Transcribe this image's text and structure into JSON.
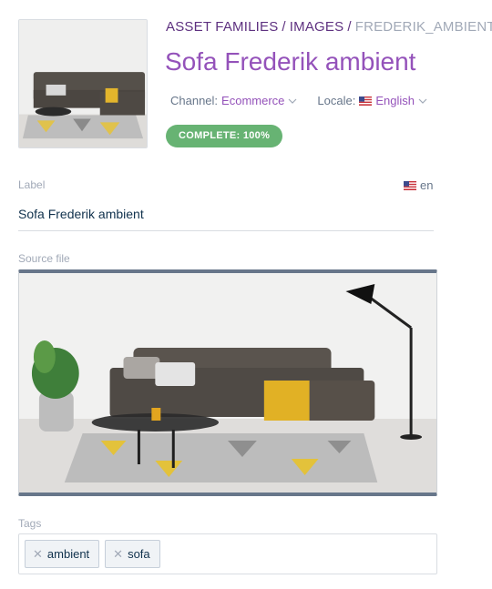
{
  "breadcrumb": {
    "root": "ASSET FAMILIES",
    "family": "IMAGES",
    "current": "FREDERIK_AMBIENT"
  },
  "title": "Sofa Frederik ambient",
  "channel": {
    "label": "Channel:",
    "value": "Ecommerce"
  },
  "locale": {
    "label": "Locale:",
    "value": "English"
  },
  "completeness": "COMPLETE: 100%",
  "fields": {
    "label": {
      "name": "Label",
      "locale": "en",
      "value": "Sofa Frederik ambient"
    },
    "source_file": {
      "name": "Source file"
    },
    "tags": {
      "name": "Tags",
      "items": [
        "ambient",
        "sofa"
      ]
    }
  },
  "colors": {
    "accent": "#9452ba",
    "breadcrumb": "#5e3180",
    "success": "#67b373"
  },
  "icons": [
    "chevron-down-icon",
    "us-flag-icon",
    "remove-tag-icon"
  ]
}
